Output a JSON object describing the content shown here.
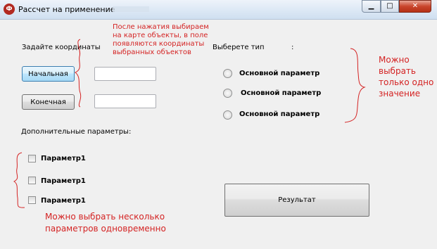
{
  "window": {
    "title": "Рассчет на применение",
    "icon": "app-icon",
    "controls": {
      "minimize": "▁",
      "maximize": "□",
      "close": "✕"
    }
  },
  "coordinates": {
    "label": "Задайте  координаты",
    "start_button": "Начальная",
    "end_button": "Конечная",
    "start_value": "",
    "end_value": "",
    "note_lines": [
      "После нажатия выбираем",
      "на карте объекты, в поле",
      "появляются координаты",
      "выбранных объектов"
    ]
  },
  "type_group": {
    "label": "Выберете тип",
    "label_suffix": ":",
    "options": [
      "Основной параметр",
      "Основной параметр",
      "Основной параметр"
    ],
    "note_lines": [
      "Можно",
      "выбрать",
      "только одно",
      "значение"
    ]
  },
  "extra": {
    "label": "Дополнительные параметры:",
    "options": [
      "Параметр1",
      "Параметр1",
      "Параметр1"
    ],
    "note_lines": [
      "Можно выбрать несколько",
      "параметров одновременно"
    ]
  },
  "result_button": "Результат",
  "colors": {
    "annotation": "#d42323",
    "window_bg": "#f0f0f0"
  }
}
